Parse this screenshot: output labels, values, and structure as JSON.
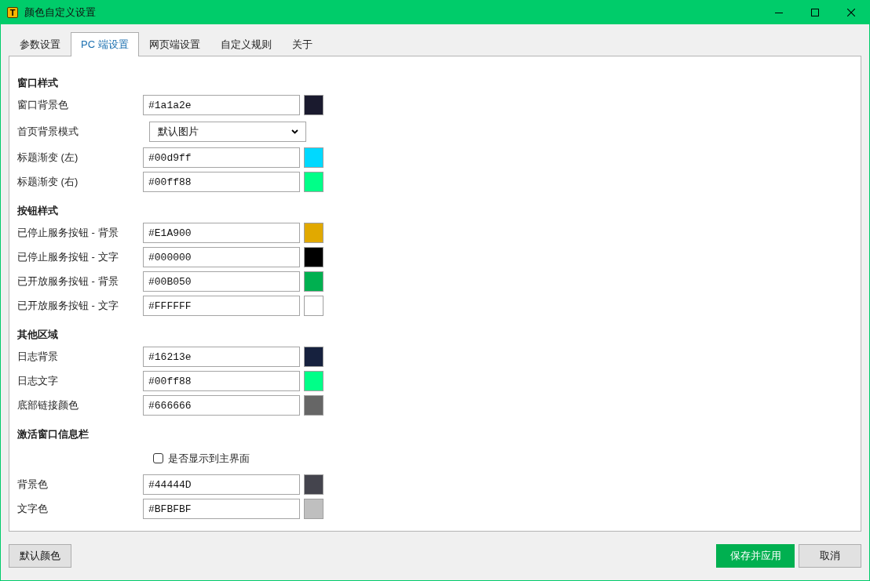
{
  "window": {
    "title": "颜色自定义设置",
    "icon_letter": "T"
  },
  "tabs": [
    {
      "label": "参数设置",
      "selected": false
    },
    {
      "label": "PC 端设置",
      "selected": true
    },
    {
      "label": "网页端设置",
      "selected": false
    },
    {
      "label": "自定义规则",
      "selected": false
    },
    {
      "label": "关于",
      "selected": false
    }
  ],
  "sections": [
    {
      "heading": "窗口样式",
      "rows": [
        {
          "kind": "color",
          "label": "窗口背景色",
          "value": "#1a1a2e",
          "color": "#1a1a2e"
        },
        {
          "kind": "select",
          "label": "首页背景模式",
          "value": "默认图片"
        },
        {
          "kind": "color",
          "label": "标题渐变 (左)",
          "value": "#00d9ff",
          "color": "#00d9ff"
        },
        {
          "kind": "color",
          "label": "标题渐变 (右)",
          "value": "#00ff88",
          "color": "#00ff88"
        }
      ]
    },
    {
      "heading": "按钮样式",
      "rows": [
        {
          "kind": "color",
          "label": "已停止服务按钮 - 背景",
          "value": "#E1A900",
          "color": "#e1a900"
        },
        {
          "kind": "color",
          "label": "已停止服务按钮 - 文字",
          "value": "#000000",
          "color": "#000000"
        },
        {
          "kind": "color",
          "label": "已开放服务按钮 - 背景",
          "value": "#00B050",
          "color": "#00b050"
        },
        {
          "kind": "color",
          "label": "已开放服务按钮 - 文字",
          "value": "#FFFFFF",
          "color": "#ffffff"
        }
      ]
    },
    {
      "heading": "其他区域",
      "rows": [
        {
          "kind": "color",
          "label": "日志背景",
          "value": "#16213e",
          "color": "#16213e"
        },
        {
          "kind": "color",
          "label": "日志文字",
          "value": "#00ff88",
          "color": "#00ff88"
        },
        {
          "kind": "color",
          "label": "底部链接颜色",
          "value": "#666666",
          "color": "#666666"
        }
      ]
    },
    {
      "heading": "激活窗口信息栏",
      "rows": [
        {
          "kind": "checkbox",
          "label": "是否显示到主界面",
          "checked": false
        },
        {
          "kind": "color",
          "label": "背景色",
          "value": "#44444D",
          "color": "#44444d"
        },
        {
          "kind": "color",
          "label": "文字色",
          "value": "#BFBFBF",
          "color": "#bfbfbf"
        }
      ]
    }
  ],
  "footer": {
    "left_buttons": [
      {
        "label": "默认颜色",
        "kind": "default"
      }
    ],
    "right_buttons": [
      {
        "label": "保存并应用",
        "kind": "primary"
      },
      {
        "label": "取消",
        "kind": "default"
      }
    ]
  }
}
